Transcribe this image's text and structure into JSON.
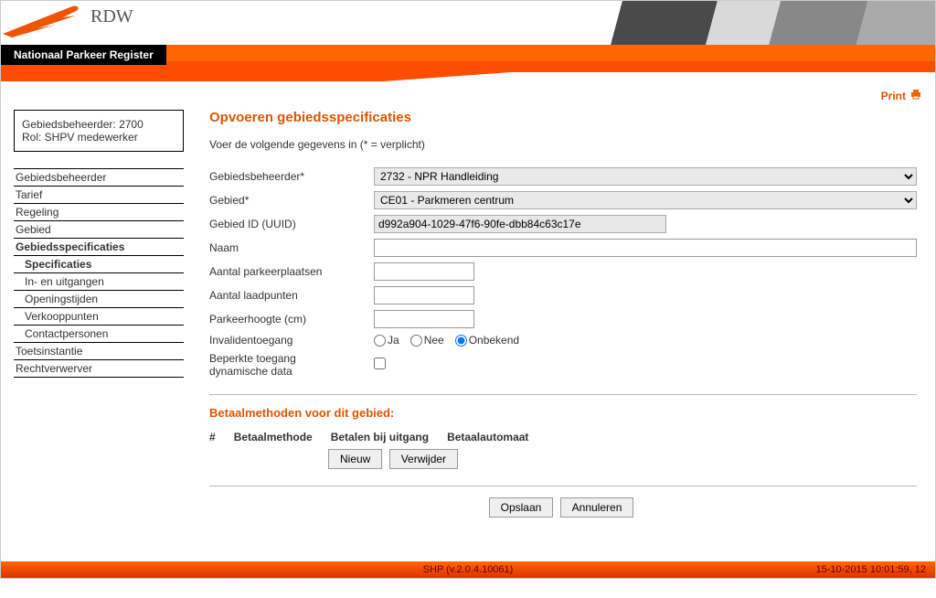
{
  "brand": "RDW",
  "system_title": "Nationaal Parkeer Register",
  "print_label": "Print",
  "user_box": {
    "line1": "Gebiedsbeheerder: 2700",
    "line2": "Rol: SHPV medewerker"
  },
  "nav": [
    {
      "label": "Gebiedsbeheerder",
      "bold": false,
      "indent": false
    },
    {
      "label": "Tarief",
      "bold": false,
      "indent": false
    },
    {
      "label": "Regeling",
      "bold": false,
      "indent": false
    },
    {
      "label": "Gebied",
      "bold": false,
      "indent": false
    },
    {
      "label": "Gebiedsspecificaties",
      "bold": true,
      "indent": false
    },
    {
      "label": "Specificaties",
      "bold": true,
      "indent": true
    },
    {
      "label": "In- en uitgangen",
      "bold": false,
      "indent": true
    },
    {
      "label": "Openingstijden",
      "bold": false,
      "indent": true
    },
    {
      "label": "Verkooppunten",
      "bold": false,
      "indent": true
    },
    {
      "label": "Contactpersonen",
      "bold": false,
      "indent": true
    },
    {
      "label": "Toetsinstantie",
      "bold": false,
      "indent": false
    },
    {
      "label": "Rechtverwerver",
      "bold": false,
      "indent": false
    }
  ],
  "page": {
    "title": "Opvoeren gebiedsspecificaties",
    "instruction": "Voer de volgende gegevens in (* = verplicht)"
  },
  "form": {
    "gebiedsbeheerder_label": "Gebiedsbeheerder*",
    "gebiedsbeheerder_value": "2732 - NPR Handleiding",
    "gebied_label": "Gebied*",
    "gebied_value": "CE01 - Parkmeren centrum",
    "uuid_label": "Gebied ID (UUID)",
    "uuid_value": "d992a904-1029-47f6-90fe-dbb84c63c17e",
    "naam_label": "Naam",
    "naam_value": "",
    "parkeerplaatsen_label": "Aantal parkeerplaatsen",
    "parkeerplaatsen_value": "",
    "laadpunten_label": "Aantal laadpunten",
    "laadpunten_value": "",
    "parkeerhoogte_label": "Parkeerhoogte (cm)",
    "parkeerhoogte_value": "",
    "invalidentoegang_label": "Invalidentoegang",
    "radio_ja": "Ja",
    "radio_nee": "Nee",
    "radio_onbekend": "Onbekend",
    "beperkte_label_1": "Beperkte toegang",
    "beperkte_label_2": "dynamische data"
  },
  "payment": {
    "section_title": "Betaalmethoden voor dit gebied:",
    "col_num": "#",
    "col_method": "Betaalmethode",
    "col_exit": "Betalen bij uitgang",
    "col_auto": "Betaalautomaat",
    "btn_new": "Nieuw",
    "btn_delete": "Verwijder"
  },
  "actions": {
    "save": "Opslaan",
    "cancel": "Annuleren"
  },
  "footer": {
    "version": "SHP (v.2.0.4.10061)",
    "timestamp": "15-10-2015 10:01:59, 12"
  }
}
